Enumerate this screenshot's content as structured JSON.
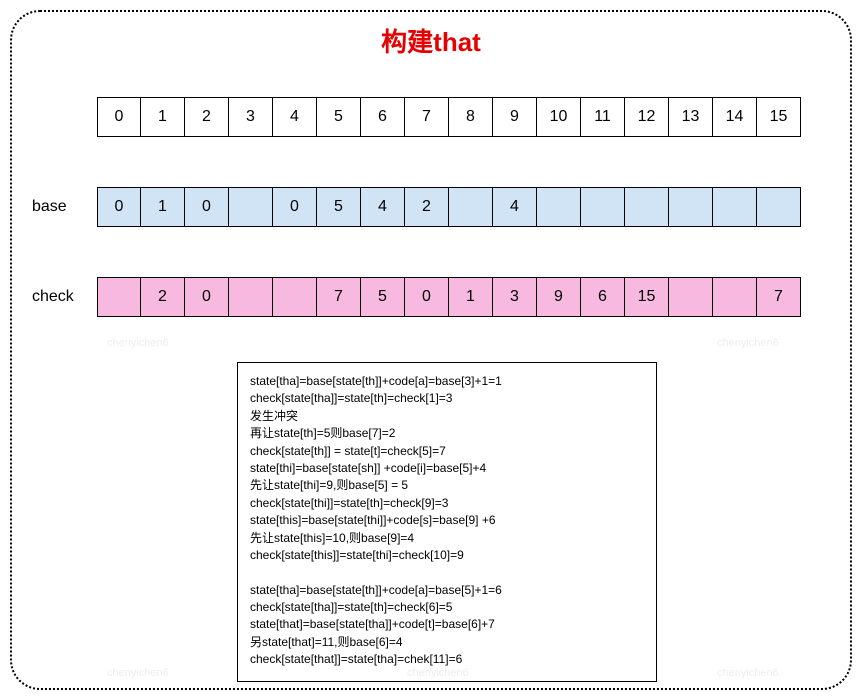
{
  "title": "构建that",
  "labels": {
    "base": "base",
    "check": "check"
  },
  "indices": [
    "0",
    "1",
    "2",
    "3",
    "4",
    "5",
    "6",
    "7",
    "8",
    "9",
    "10",
    "11",
    "12",
    "13",
    "14",
    "15"
  ],
  "base": [
    "0",
    "1",
    "0",
    "",
    "0",
    "5",
    "4",
    "2",
    "",
    "4",
    "",
    "",
    "",
    "",
    "",
    ""
  ],
  "check": [
    "",
    "2",
    "0",
    "",
    "",
    "7",
    "5",
    "0",
    "1",
    "3",
    "9",
    "6",
    "15",
    "",
    "",
    "7"
  ],
  "textbox": "state[tha]=base[state[th]]+code[a]=base[3]+1=1\ncheck[state[tha]]=state[th]=check[1]=3\n发生冲突\n再让state[th]=5则base[7]=2\ncheck[state[th]] = state[t]=check[5]=7\nstate[thi]=base[state[sh]] +code[i]=base[5]+4\n先让state[thi]=9,则base[5] = 5\ncheck[state[thi]]=state[th]=check[9]=3\nstate[this]=base[state[thi]]+code[s]=base[9] +6\n先让state[this]=10,则base[9]=4\ncheck[state[this]]=state[thi]=check[10]=9\n\nstate[tha]=base[state[th]]+code[a]=base[5]+1=6\ncheck[state[tha]]=state[th]=check[6]=5\nstate[that]=base[state[tha]]+code[t]=base[6]+7\n另state[that]=11,则base[6]=4\ncheck[state[that]]=state[tha]=chek[11]=6",
  "watermark": "chenyichen6"
}
